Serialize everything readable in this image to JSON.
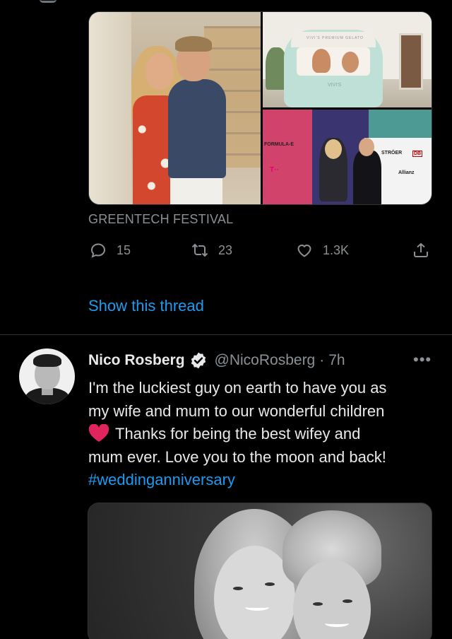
{
  "previous_tweet": {
    "media_alt": [
      "couple-portrait-photo",
      "gelato-van-photo",
      "formula-e-red-carpet-photo"
    ],
    "media_text": {
      "van_sign": "VIVI'S PREMIUM GELATO",
      "van_brand": "VIVI'S",
      "backdrop_logos": [
        "FORMULA-E",
        "STRÖER",
        "DB",
        "Allianz",
        "T··"
      ]
    },
    "card_caption": "GREENTECH FESTIVAL",
    "actions": {
      "reply_count": "15",
      "retweet_count": "23",
      "like_count": "1.3K"
    },
    "show_thread_label": "Show this thread"
  },
  "tweet": {
    "author_name": "Nico Rosberg",
    "handle": "@NicoRosberg",
    "separator": "·",
    "time": "7h",
    "more_label": "•••",
    "text_lines": [
      "I'm the luckiest guy on earth to have you as",
      "my wife and mum to our wonderful children",
      "Thanks for being the best wifey and",
      "mum ever. Love you to the moon and back!"
    ],
    "hashtag": "#weddinganniversary",
    "emoji": "red-heart"
  },
  "colors": {
    "background": "#000000",
    "text": "#e7e9ea",
    "muted": "#8b9095",
    "link": "#1d9bf0",
    "heart": "#e0245e",
    "divider": "#2f3336"
  },
  "icons": [
    "reply-icon",
    "retweet-icon",
    "like-icon",
    "share-icon",
    "verified-badge-icon",
    "more-icon",
    "heart-emoji-icon"
  ]
}
